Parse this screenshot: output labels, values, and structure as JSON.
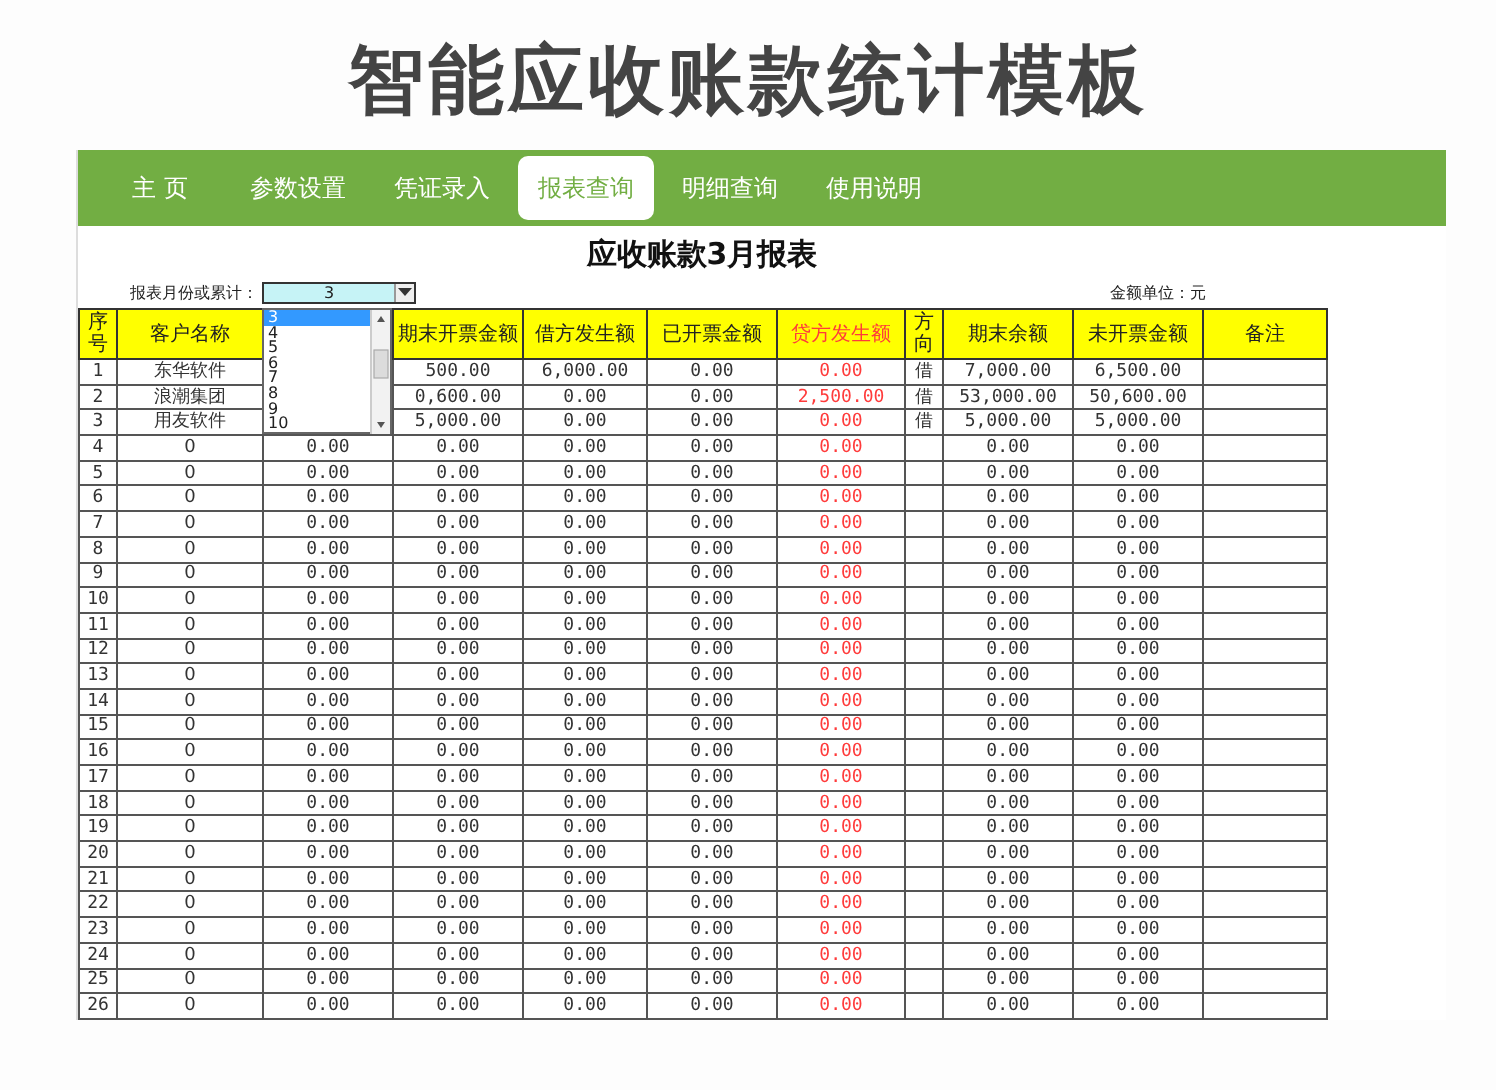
{
  "page_title": "智能应收账款统计模板",
  "tabs": [
    {
      "label": "主 页",
      "selected": false
    },
    {
      "label": "参数设置",
      "selected": false
    },
    {
      "label": "凭证录入",
      "selected": false
    },
    {
      "label": "报表查询",
      "selected": true
    },
    {
      "label": "明细查询",
      "selected": false
    },
    {
      "label": "使用说明",
      "selected": false
    }
  ],
  "report_title": "应收账款3月报表",
  "month_label": "报表月份或累计：",
  "month_select": {
    "value": "3",
    "expanded": true,
    "options": [
      {
        "label": "3",
        "selected": true
      },
      {
        "label": "4",
        "selected": false
      },
      {
        "label": "5",
        "selected": false
      },
      {
        "label": "6",
        "selected": false
      },
      {
        "label": "7",
        "selected": false
      },
      {
        "label": "8",
        "selected": false
      },
      {
        "label": "9",
        "selected": false
      },
      {
        "label": "10",
        "selected": false
      }
    ]
  },
  "unit_note": "金额单位：元",
  "table": {
    "columns": [
      {
        "label": "序号",
        "accent": false
      },
      {
        "label": "客户名称",
        "accent": false
      },
      {},
      {
        "label": "期末开票金额",
        "accent": false
      },
      {
        "label": "借方发生额",
        "accent": false
      },
      {
        "label": "已开票金额",
        "accent": false
      },
      {
        "label": "贷方发生额",
        "accent": true
      },
      {
        "label": "方向",
        "accent": false
      },
      {
        "label": "期末余额",
        "accent": false
      },
      {
        "label": "未开票金额",
        "accent": false
      },
      {
        "label": "备注",
        "accent": false
      }
    ],
    "rows": [
      [
        "1",
        "东华软件",
        null,
        "500.00",
        "6,000.00",
        "0.00",
        "0.00",
        "借",
        "7,000.00",
        "6,500.00",
        ""
      ],
      [
        "2",
        "浪潮集团",
        null,
        "0,600.00",
        "0.00",
        "0.00",
        "2,500.00",
        "借",
        "53,000.00",
        "50,600.00",
        ""
      ],
      [
        "3",
        "用友软件",
        null,
        "5,000.00",
        "0.00",
        "0.00",
        "0.00",
        "借",
        "5,000.00",
        "5,000.00",
        ""
      ],
      [
        "4",
        "0",
        "0.00",
        "0.00",
        "0.00",
        "0.00",
        "0.00",
        "",
        "0.00",
        "0.00",
        ""
      ],
      [
        "5",
        "0",
        "0.00",
        "0.00",
        "0.00",
        "0.00",
        "0.00",
        "",
        "0.00",
        "0.00",
        ""
      ],
      [
        "6",
        "0",
        "0.00",
        "0.00",
        "0.00",
        "0.00",
        "0.00",
        "",
        "0.00",
        "0.00",
        ""
      ],
      [
        "7",
        "0",
        "0.00",
        "0.00",
        "0.00",
        "0.00",
        "0.00",
        "",
        "0.00",
        "0.00",
        ""
      ],
      [
        "8",
        "0",
        "0.00",
        "0.00",
        "0.00",
        "0.00",
        "0.00",
        "",
        "0.00",
        "0.00",
        ""
      ],
      [
        "9",
        "0",
        "0.00",
        "0.00",
        "0.00",
        "0.00",
        "0.00",
        "",
        "0.00",
        "0.00",
        ""
      ],
      [
        "10",
        "0",
        "0.00",
        "0.00",
        "0.00",
        "0.00",
        "0.00",
        "",
        "0.00",
        "0.00",
        ""
      ],
      [
        "11",
        "0",
        "0.00",
        "0.00",
        "0.00",
        "0.00",
        "0.00",
        "",
        "0.00",
        "0.00",
        ""
      ],
      [
        "12",
        "0",
        "0.00",
        "0.00",
        "0.00",
        "0.00",
        "0.00",
        "",
        "0.00",
        "0.00",
        ""
      ],
      [
        "13",
        "0",
        "0.00",
        "0.00",
        "0.00",
        "0.00",
        "0.00",
        "",
        "0.00",
        "0.00",
        ""
      ],
      [
        "14",
        "0",
        "0.00",
        "0.00",
        "0.00",
        "0.00",
        "0.00",
        "",
        "0.00",
        "0.00",
        ""
      ],
      [
        "15",
        "0",
        "0.00",
        "0.00",
        "0.00",
        "0.00",
        "0.00",
        "",
        "0.00",
        "0.00",
        ""
      ],
      [
        "16",
        "0",
        "0.00",
        "0.00",
        "0.00",
        "0.00",
        "0.00",
        "",
        "0.00",
        "0.00",
        ""
      ],
      [
        "17",
        "0",
        "0.00",
        "0.00",
        "0.00",
        "0.00",
        "0.00",
        "",
        "0.00",
        "0.00",
        ""
      ],
      [
        "18",
        "0",
        "0.00",
        "0.00",
        "0.00",
        "0.00",
        "0.00",
        "",
        "0.00",
        "0.00",
        ""
      ],
      [
        "19",
        "0",
        "0.00",
        "0.00",
        "0.00",
        "0.00",
        "0.00",
        "",
        "0.00",
        "0.00",
        ""
      ],
      [
        "20",
        "0",
        "0.00",
        "0.00",
        "0.00",
        "0.00",
        "0.00",
        "",
        "0.00",
        "0.00",
        ""
      ],
      [
        "21",
        "0",
        "0.00",
        "0.00",
        "0.00",
        "0.00",
        "0.00",
        "",
        "0.00",
        "0.00",
        ""
      ],
      [
        "22",
        "0",
        "0.00",
        "0.00",
        "0.00",
        "0.00",
        "0.00",
        "",
        "0.00",
        "0.00",
        ""
      ],
      [
        "23",
        "0",
        "0.00",
        "0.00",
        "0.00",
        "0.00",
        "0.00",
        "",
        "0.00",
        "0.00",
        ""
      ],
      [
        "24",
        "0",
        "0.00",
        "0.00",
        "0.00",
        "0.00",
        "0.00",
        "",
        "0.00",
        "0.00",
        ""
      ],
      [
        "25",
        "0",
        "0.00",
        "0.00",
        "0.00",
        "0.00",
        "0.00",
        "",
        "0.00",
        "0.00",
        ""
      ],
      [
        "26",
        "0",
        "0.00",
        "0.00",
        "0.00",
        "0.00",
        "0.00",
        "",
        "0.00",
        "0.00",
        ""
      ]
    ]
  }
}
